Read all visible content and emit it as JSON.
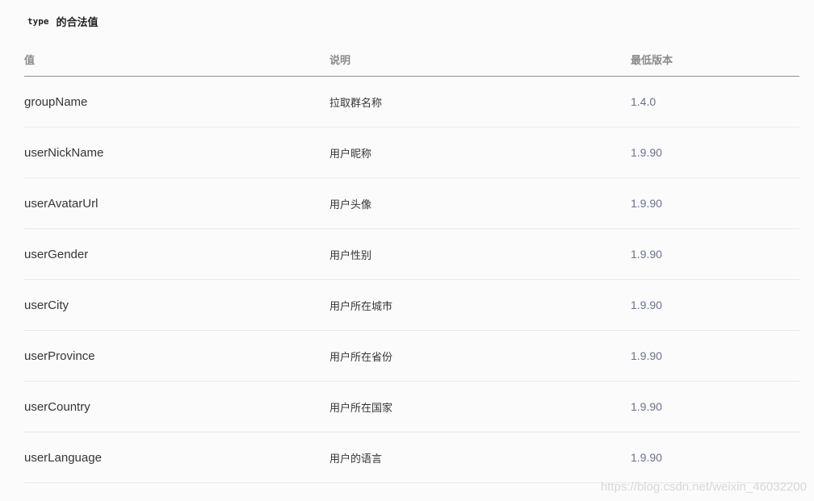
{
  "section": {
    "code": "type",
    "title": "的合法值"
  },
  "table": {
    "headers": [
      "值",
      "说明",
      "最低版本"
    ],
    "rows": [
      {
        "value": "groupName",
        "desc": "拉取群名称",
        "version": "1.4.0"
      },
      {
        "value": "userNickName",
        "desc": "用户昵称",
        "version": "1.9.90"
      },
      {
        "value": "userAvatarUrl",
        "desc": "用户头像",
        "version": "1.9.90"
      },
      {
        "value": "userGender",
        "desc": "用户性别",
        "version": "1.9.90"
      },
      {
        "value": "userCity",
        "desc": "用户所在城市",
        "version": "1.9.90"
      },
      {
        "value": "userProvince",
        "desc": "用户所在省份",
        "version": "1.9.90"
      },
      {
        "value": "userCountry",
        "desc": "用户所在国家",
        "version": "1.9.90"
      },
      {
        "value": "userLanguage",
        "desc": "用户的语言",
        "version": "1.9.90"
      }
    ]
  },
  "watermark": "https://blog.csdn.net/weixin_46032200"
}
